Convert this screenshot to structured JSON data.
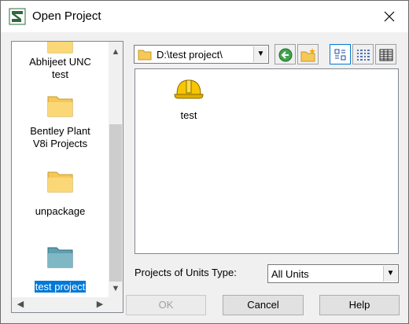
{
  "window": {
    "title": "Open Project"
  },
  "folder_pane": {
    "items": [
      {
        "label_lines": [
          "Abhijeet UNC",
          "test"
        ],
        "icon": "folder-icon"
      },
      {
        "label_lines": [
          "Bentley Plant",
          "V8i Projects"
        ],
        "icon": "folder-icon"
      },
      {
        "label_lines": [
          "unpackage"
        ],
        "icon": "folder-icon"
      },
      {
        "label_lines": [
          "test project"
        ],
        "icon": "folder-open-icon",
        "selected": true
      }
    ]
  },
  "path_combo": {
    "value": "D:\\test project\\"
  },
  "toolbar": {
    "buttons": [
      "back-icon",
      "new-folder-icon",
      "large-icons-view-icon",
      "list-view-icon",
      "details-view-icon"
    ]
  },
  "file_list": {
    "items": [
      {
        "label": "test",
        "icon": "hard-hat-icon"
      }
    ]
  },
  "units_type": {
    "label": "Projects of Units Type:",
    "value": "All Units"
  },
  "buttons": {
    "ok": "OK",
    "cancel": "Cancel",
    "help": "Help"
  }
}
